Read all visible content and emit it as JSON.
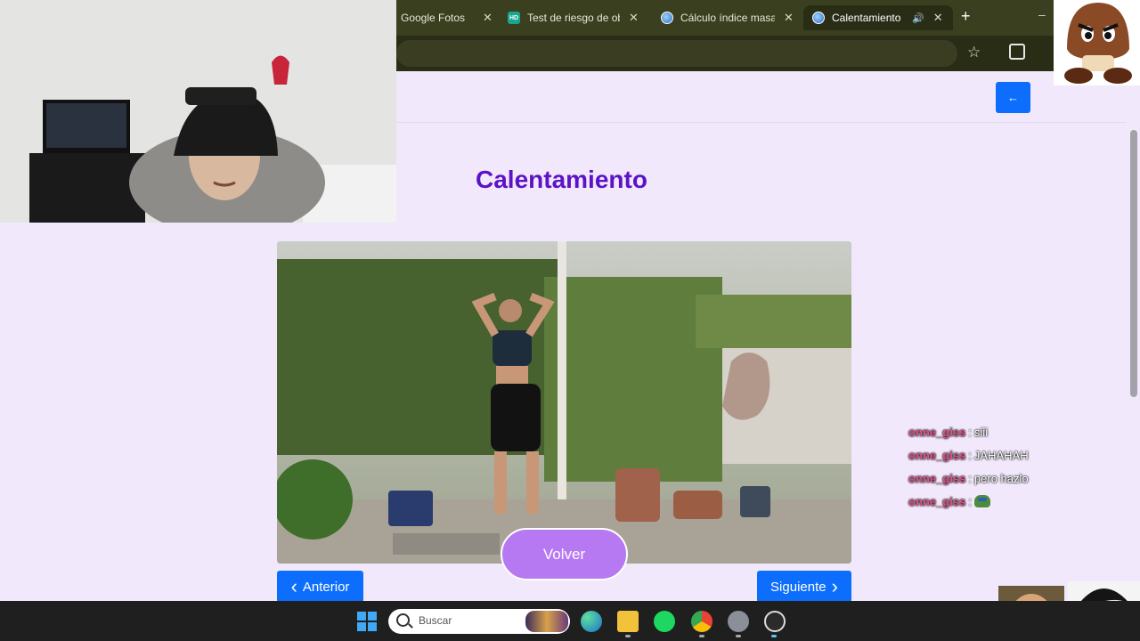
{
  "browser": {
    "tabs": [
      {
        "title": "Google Fotos",
        "icon": "google-photos-icon",
        "active": false
      },
      {
        "title": "Test de riesgo de obe",
        "icon": "hd-site-icon",
        "active": false
      },
      {
        "title": "Cálculo índice masa c",
        "icon": "globe-icon",
        "active": false
      },
      {
        "title": "Calentamiento",
        "icon": "globe-icon",
        "active": true,
        "audio": true
      }
    ],
    "new_tab_label": "+",
    "close_glyph": "✕",
    "audio_glyph": "🔊"
  },
  "page": {
    "title": "Calentamiento",
    "back_button_glyph": "←",
    "volver_label": "Volver",
    "anterior_label": "Anterior",
    "siguiente_label": "Siguiente",
    "anterior_glyph": "‹",
    "siguiente_glyph": "›"
  },
  "chat": {
    "messages": [
      {
        "user": "onne_giss",
        "text": "siii"
      },
      {
        "user": "onne_giss",
        "text": "JAHAHAH"
      },
      {
        "user": "onne_giss",
        "text": "pero hazlo"
      },
      {
        "user": "onne_giss",
        "text": "",
        "emote": "pepe-emote-icon"
      }
    ],
    "separator": ":"
  },
  "taskbar": {
    "search_placeholder": "Buscar",
    "apps": [
      "windows-start-icon",
      "edge-icon",
      "file-explorer-icon",
      "spotify-icon",
      "chrome-icon",
      "settings-icon",
      "obs-icon"
    ]
  },
  "colors": {
    "accent": "#0d6efd",
    "title": "#5b12c9",
    "volver": "#b679f2",
    "page_bg": "#f1e9fb",
    "chat_user": "#e0548b"
  }
}
